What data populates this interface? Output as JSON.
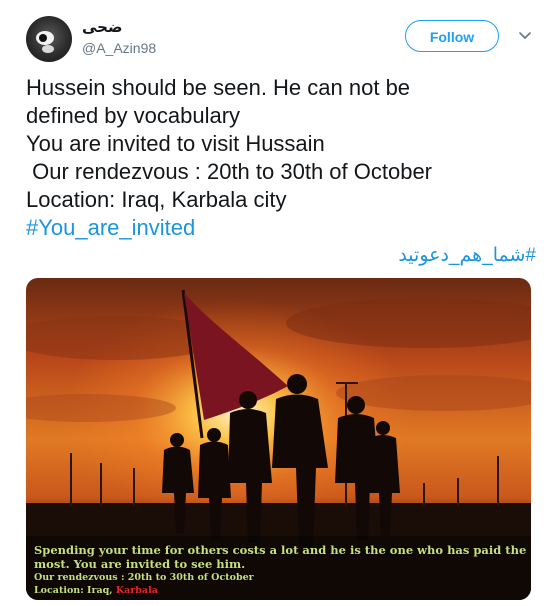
{
  "user": {
    "display_name": "ضحی",
    "handle": "@A_Azin98"
  },
  "actions": {
    "follow_label": "Follow",
    "more_icon": "chevron-down-icon"
  },
  "tweet": {
    "lines": [
      "Hussein should be seen. He can not be",
      "defined by vocabulary",
      "You are invited to visit Hussain",
      " Our rendezvous : 20th to 30th of October",
      "Location: Iraq, Karbala city"
    ],
    "hashtags": [
      "#You_are_invited",
      "#شما_هم_دعوتید"
    ]
  },
  "photo": {
    "caption_line1": "Spending your time for others costs a lot and he is the one who has paid the most. You are invited to see him.",
    "caption_line2": "Our rendezvous : 20th to 30th of October",
    "caption_location_prefix": "Location: Iraq, ",
    "caption_location_city": "Karbala"
  },
  "colors": {
    "accent": "#1da1f2",
    "hashtag": "#1b95e0",
    "caption_text": "#c8e07a",
    "caption_city": "#e8252c"
  }
}
